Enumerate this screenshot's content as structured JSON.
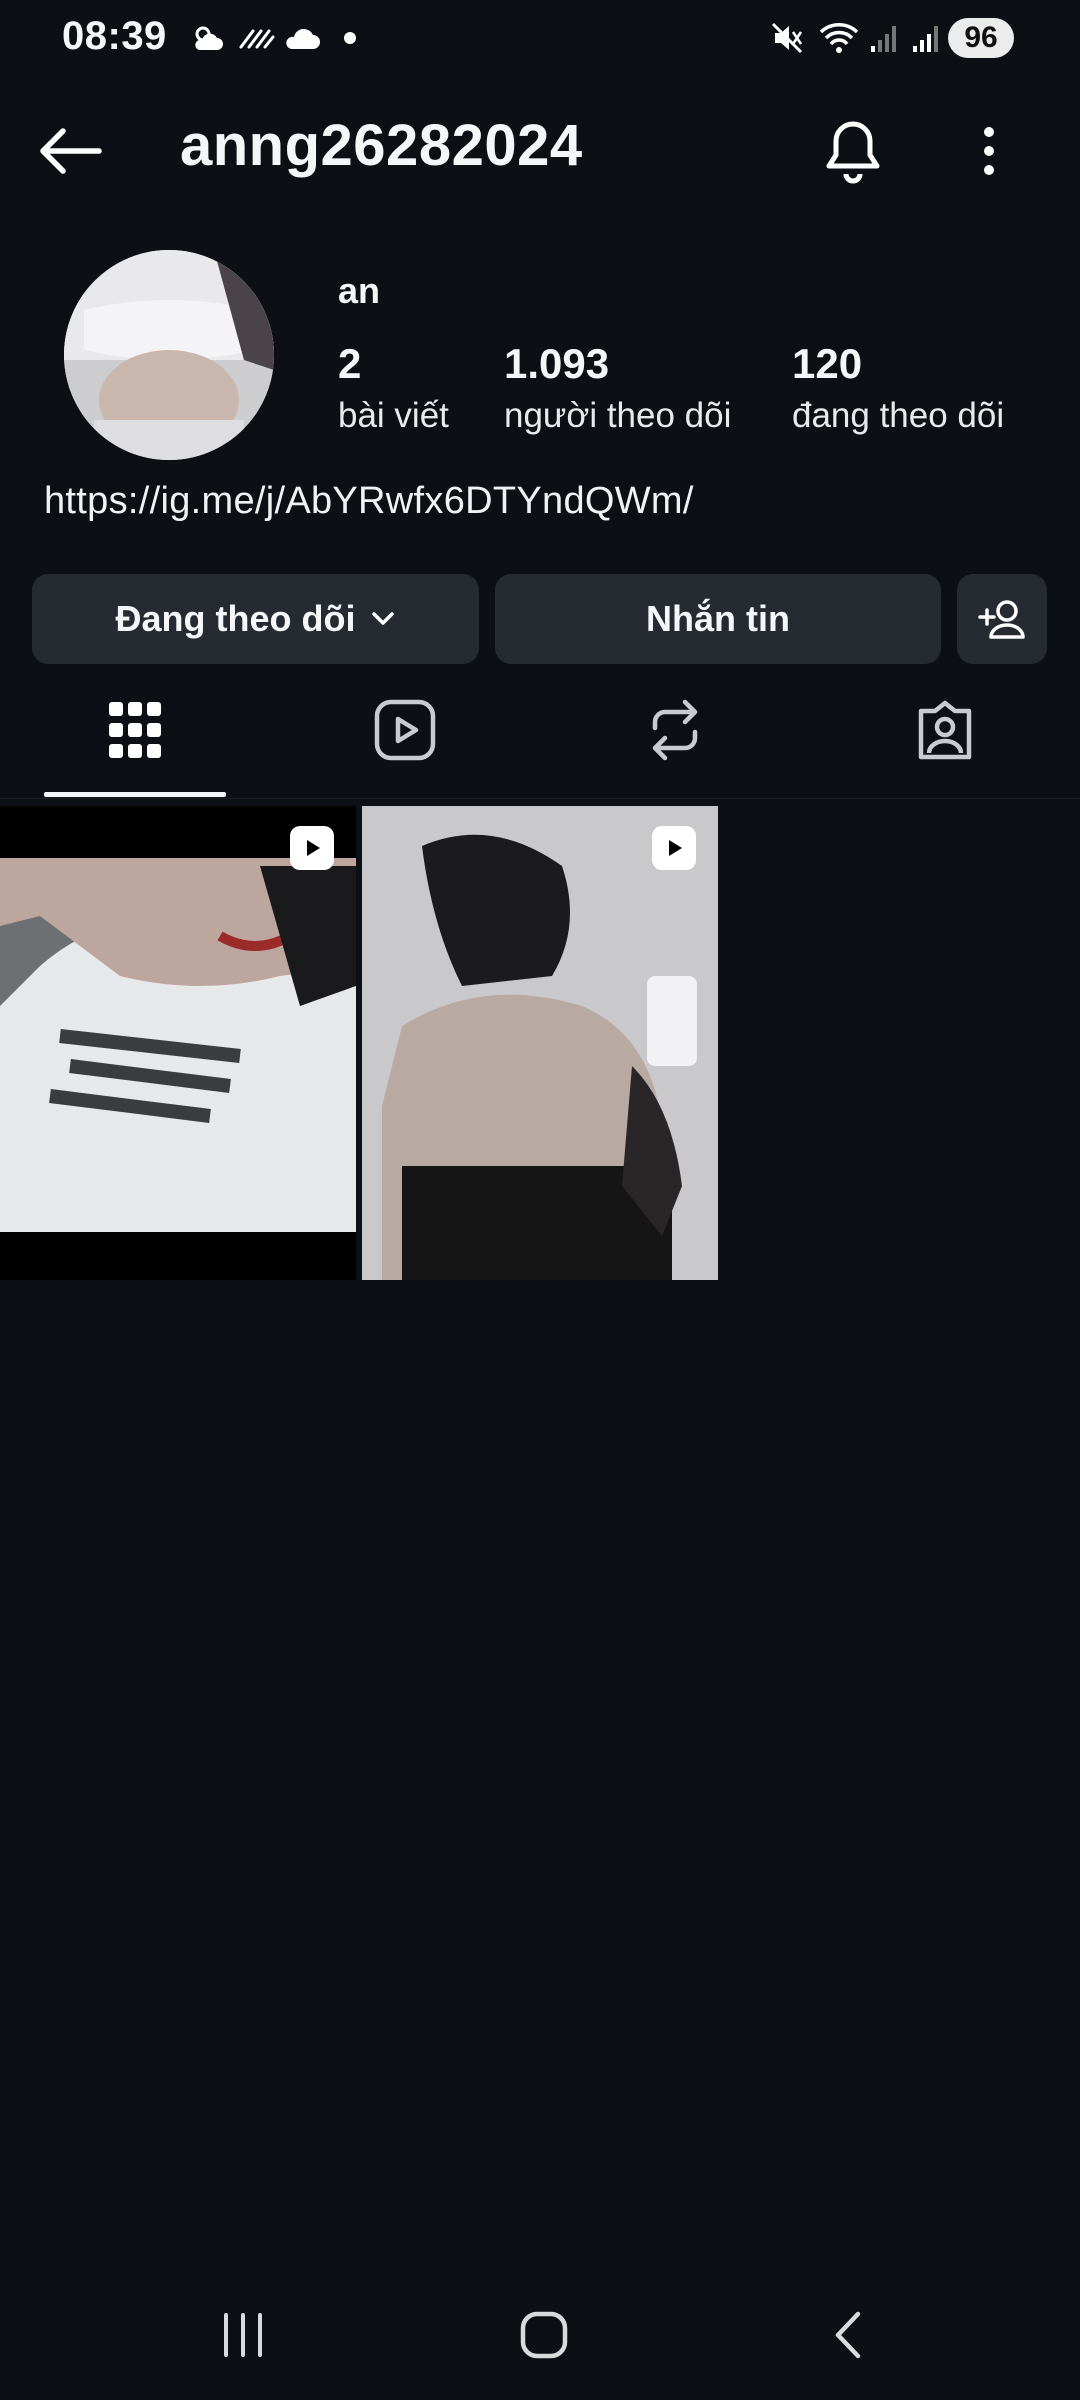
{
  "status_bar": {
    "time": "08:39",
    "battery": "96",
    "icons": [
      "weather-sun-cloud-icon",
      "haze-icon",
      "cloud-icon",
      "dot-icon",
      "mute-icon",
      "wifi-icon",
      "signal-1-icon",
      "signal-2-icon"
    ]
  },
  "header": {
    "username": "anng26282024",
    "icons": [
      "back-arrow-icon",
      "bell-icon",
      "more-vertical-icon"
    ]
  },
  "profile": {
    "display_name": "an",
    "stats": [
      {
        "value": "2",
        "label": "bài viết"
      },
      {
        "value": "1.093",
        "label": "người theo dõi"
      },
      {
        "value": "120",
        "label": "đang theo dõi"
      }
    ],
    "link": "https://ig.me/j/AbYRwfx6DTYndQWm/"
  },
  "actions": {
    "following_label": "Đang theo dõi",
    "message_label": "Nhắn tin",
    "icons": [
      "chevron-down-icon",
      "add-person-icon"
    ]
  },
  "tabs": {
    "active": "grid",
    "icons": [
      "grid-icon",
      "reels-icon",
      "reposts-icon",
      "tagged-icon"
    ]
  },
  "posts": [
    {
      "type": "reel",
      "icon": "reel-play-icon"
    },
    {
      "type": "reel",
      "icon": "reel-play-icon"
    }
  ],
  "nav_bar": {
    "icons": [
      "recent-apps-icon",
      "home-icon",
      "back-icon"
    ]
  },
  "colors": {
    "background": "#0c0f14",
    "button": "#262a31",
    "text": "#f5f6f7"
  }
}
